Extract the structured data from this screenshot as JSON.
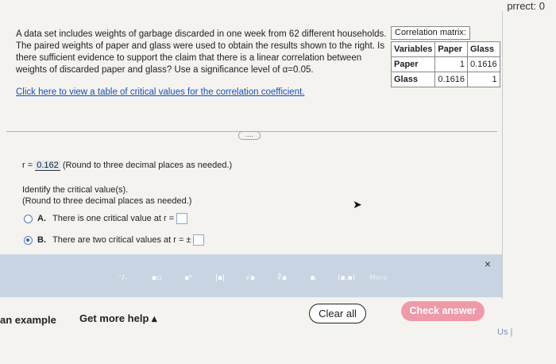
{
  "header": {
    "correct_label": "prrect: 0"
  },
  "question": {
    "text": "A data set includes weights of garbage discarded in one week from 62 different households. The paired weights of paper and glass were used to obtain the results shown to the right. Is there sufficient evidence to support the claim that there is a linear correlation between weights of discarded paper and glass? Use a significance level of α=0.05.",
    "link": "Click here to view a table of critical values for the correlation coefficient."
  },
  "correlation": {
    "title": "Correlation matrix:",
    "headers": [
      "Variables",
      "Paper",
      "Glass"
    ],
    "rows": [
      {
        "label": "Paper",
        "paper": "1",
        "glass": "0.1616"
      },
      {
        "label": "Glass",
        "paper": "0.1616",
        "glass": "1"
      }
    ]
  },
  "answer": {
    "prefix": "r =",
    "value": "0.162",
    "hint": "(Round to three decimal places as needed.)"
  },
  "identify": {
    "line1": "Identify the critical value(s).",
    "line2": "(Round to three decimal places as needed.)"
  },
  "options": [
    {
      "letter": "A.",
      "text": "There is one critical value at r =",
      "selected": false
    },
    {
      "letter": "B.",
      "text": "There are two critical values at r = ±",
      "selected": true
    }
  ],
  "toolbar": {
    "expand_label": "....",
    "tools": [
      "⁻/₋",
      "▪▫",
      "▪ⁿ",
      "|▪|",
      "√▪",
      "∛▪",
      "▪.",
      "(▪,▪)"
    ],
    "more_label": "More",
    "close_label": "×"
  },
  "footer": {
    "example_label": "an example",
    "help_label": "Get more help ▴",
    "clear_label": "Clear all",
    "check_label": "Check answer",
    "us_label": "Us |"
  },
  "colors": {
    "link": "#1a4fb8",
    "toolbar_bg": "#c9d4e3",
    "check_button": "#ee9aa8"
  }
}
